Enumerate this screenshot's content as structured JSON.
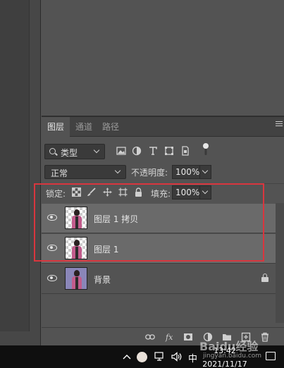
{
  "layers_panel": {
    "tabs": [
      {
        "label": "图层",
        "active": true
      },
      {
        "label": "通道",
        "active": false
      },
      {
        "label": "路径",
        "active": false
      }
    ],
    "filter": {
      "kind_label": "类型"
    },
    "blend_mode": "正常",
    "opacity_label": "不透明度:",
    "opacity_value": "100%",
    "lock_label": "锁定:",
    "fill_label": "填充:",
    "fill_value": "100%",
    "layers": [
      {
        "name": "图层 1 拷贝",
        "visible": true,
        "selected": true,
        "transparent_thumb": true
      },
      {
        "name": "图层 1",
        "visible": true,
        "selected": true,
        "transparent_thumb": true
      },
      {
        "name": "背景",
        "visible": true,
        "selected": false,
        "locked": true,
        "transparent_thumb": false
      }
    ],
    "bottom_icons": [
      "link-icon",
      "fx-icon",
      "mask-icon",
      "adjustment-icon",
      "folder-icon",
      "new-layer-icon",
      "trash-icon"
    ]
  },
  "taskbar": {
    "ime": "中",
    "time": "13:42",
    "date": "2021/11/17"
  },
  "watermark": {
    "brand": "Baidu经验",
    "url": "jingyan.baidu.com"
  },
  "colors": {
    "highlight_border": "#d9363e",
    "selected_row": "#6a6a6a",
    "panel_bg": "#535353"
  }
}
